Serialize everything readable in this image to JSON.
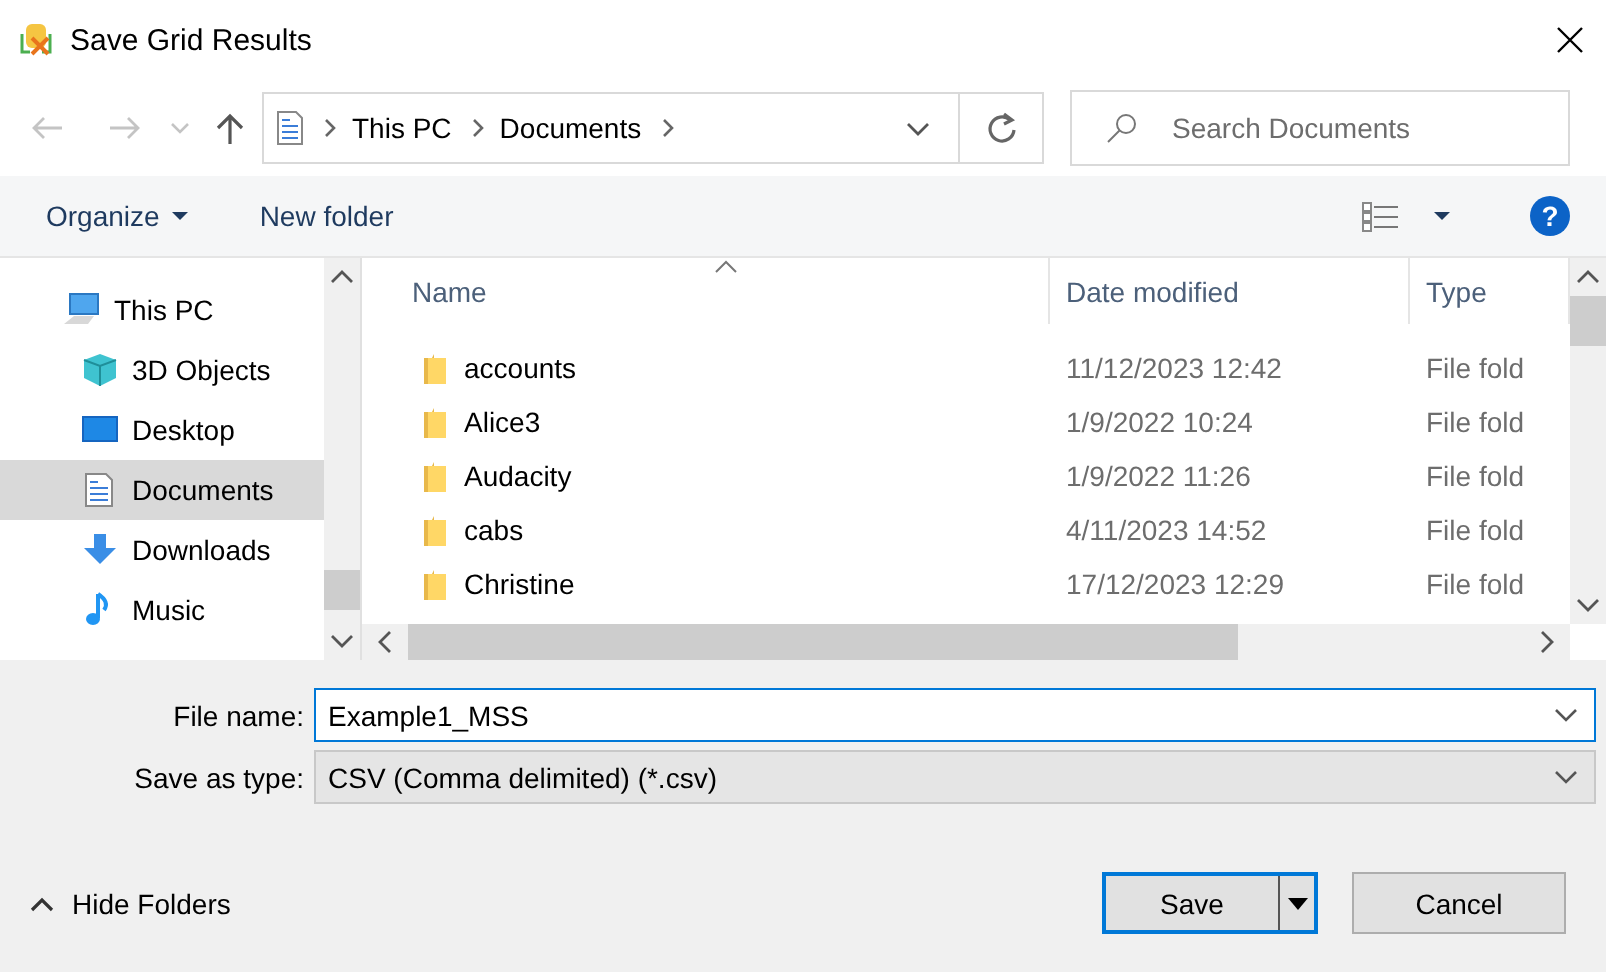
{
  "window": {
    "title": "Save Grid Results"
  },
  "nav": {
    "breadcrumb": [
      "This PC",
      "Documents"
    ],
    "search": {
      "placeholder": "Search Documents"
    }
  },
  "toolbar": {
    "organize": "Organize",
    "new_folder": "New folder",
    "help": "?"
  },
  "sidebar": {
    "items": [
      {
        "label": "This PC",
        "kind": "pc",
        "selected": false,
        "children": [
          {
            "label": "3D Objects",
            "kind": "cube",
            "selected": false
          },
          {
            "label": "Desktop",
            "kind": "desktop",
            "selected": false
          },
          {
            "label": "Documents",
            "kind": "documents",
            "selected": true
          },
          {
            "label": "Downloads",
            "kind": "downloads",
            "selected": false
          },
          {
            "label": "Music",
            "kind": "music",
            "selected": false
          }
        ]
      }
    ]
  },
  "table": {
    "columns": [
      "Name",
      "Date modified",
      "Type"
    ],
    "rows": [
      {
        "name": "accounts",
        "date": "11/12/2023 12:42",
        "type": "File fold"
      },
      {
        "name": "Alice3",
        "date": "1/9/2022 10:24",
        "type": "File fold"
      },
      {
        "name": "Audacity",
        "date": "1/9/2022 11:26",
        "type": "File fold"
      },
      {
        "name": "cabs",
        "date": "4/11/2023 14:52",
        "type": "File fold"
      },
      {
        "name": "Christine",
        "date": "17/12/2023 12:29",
        "type": "File fold"
      }
    ]
  },
  "form": {
    "file_name": {
      "label": "File name:",
      "value": "Example1_MSS"
    },
    "save_type": {
      "label": "Save as type:",
      "value": "CSV (Comma delimited) (*.csv)"
    }
  },
  "footer": {
    "hide_folders": "Hide Folders",
    "buttons": [
      "Save",
      "Cancel"
    ]
  }
}
